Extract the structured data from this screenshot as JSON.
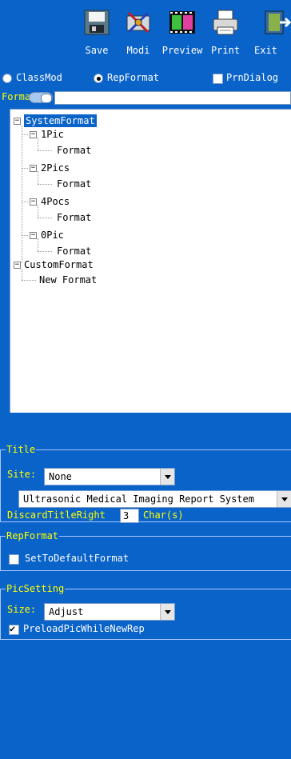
{
  "toolbar": {
    "save_label": "Save",
    "modi_label": "Modi",
    "preview_label": "Preview",
    "print_label": "Print",
    "exit_label": "Exit"
  },
  "mode": {
    "classmod_label": "ClassMod",
    "repformat_label": "RepFormat",
    "selected": "RepFormat",
    "prndialog_label": "PrnDialog",
    "prndialog_checked": false
  },
  "format": {
    "label": "Format",
    "value": ""
  },
  "tree": {
    "root1": "SystemFormat",
    "pic1": "1Pic",
    "pic1_child": "Format",
    "pic2": "2Pics",
    "pic2_child": "Format",
    "pic4": "4Pocs",
    "pic4_child": "Format",
    "pic0": "0Pic",
    "pic0_child": "Format",
    "root2": "CustomFormat",
    "custom_child": "New Format"
  },
  "title_group": {
    "title": "Title",
    "site_label": "Site:",
    "site_value": "None",
    "report_title": "Ultrasonic Medical Imaging Report System",
    "discard_label": "DiscardTitleRight",
    "discard_value": "3",
    "chars_label": "Char(s)"
  },
  "repformat_group": {
    "title": "RepFormat",
    "default_label": "SetToDefaultFormat",
    "default_checked": false
  },
  "picsetting_group": {
    "title": "PicSetting",
    "size_label": "Size:",
    "size_value": "Adjust",
    "preload_label": "PreloadPicWhileNewRep",
    "preload_checked": true
  },
  "colors": {
    "background": "#0a63c8",
    "label_yellow": "#ffff00",
    "selection": "#0a63c8"
  }
}
